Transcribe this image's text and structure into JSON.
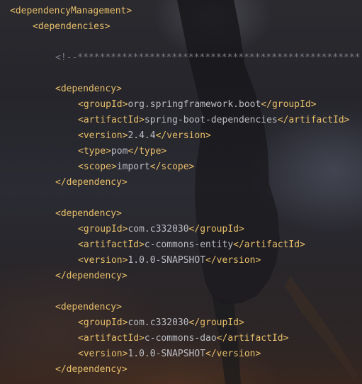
{
  "editor": {
    "colors": {
      "tag": "#e8bf6a",
      "text": "#bcbec4",
      "comment": "#7a7e85",
      "background": "#25252b"
    },
    "background_image": "dark-figure-with-guitar-wallpaper",
    "lines": [
      {
        "indent": 0,
        "segments": [
          {
            "kind": "tag",
            "text": "<dependencyManagement>"
          }
        ]
      },
      {
        "indent": 1,
        "segments": [
          {
            "kind": "tag",
            "text": "<dependencies>"
          }
        ]
      },
      {
        "indent": 0,
        "segments": []
      },
      {
        "indent": 2,
        "segments": [
          {
            "kind": "comment",
            "text": "<!--***************************************************"
          }
        ]
      },
      {
        "indent": 0,
        "segments": []
      },
      {
        "indent": 2,
        "segments": [
          {
            "kind": "tag",
            "text": "<dependency>"
          }
        ]
      },
      {
        "indent": 3,
        "segments": [
          {
            "kind": "tag",
            "text": "<groupId>"
          },
          {
            "kind": "txt",
            "text": "org.springframework.boot"
          },
          {
            "kind": "tag",
            "text": "</groupId>"
          }
        ]
      },
      {
        "indent": 3,
        "segments": [
          {
            "kind": "tag",
            "text": "<artifactId>"
          },
          {
            "kind": "txt",
            "text": "spring-boot-dependencies"
          },
          {
            "kind": "tag",
            "text": "</artifactId>"
          }
        ]
      },
      {
        "indent": 3,
        "segments": [
          {
            "kind": "tag",
            "text": "<version>"
          },
          {
            "kind": "txt",
            "text": "2.4.4"
          },
          {
            "kind": "tag",
            "text": "</version>"
          }
        ]
      },
      {
        "indent": 3,
        "segments": [
          {
            "kind": "tag",
            "text": "<type>"
          },
          {
            "kind": "txt",
            "text": "pom"
          },
          {
            "kind": "tag",
            "text": "</type>"
          }
        ]
      },
      {
        "indent": 3,
        "segments": [
          {
            "kind": "tag",
            "text": "<scope>"
          },
          {
            "kind": "txt",
            "text": "import"
          },
          {
            "kind": "tag",
            "text": "</scope>"
          }
        ]
      },
      {
        "indent": 2,
        "segments": [
          {
            "kind": "tag",
            "text": "</dependency>"
          }
        ]
      },
      {
        "indent": 0,
        "segments": []
      },
      {
        "indent": 2,
        "segments": [
          {
            "kind": "tag",
            "text": "<dependency>"
          }
        ]
      },
      {
        "indent": 3,
        "segments": [
          {
            "kind": "tag",
            "text": "<groupId>"
          },
          {
            "kind": "txt",
            "text": "com.c332030"
          },
          {
            "kind": "tag",
            "text": "</groupId>"
          }
        ]
      },
      {
        "indent": 3,
        "segments": [
          {
            "kind": "tag",
            "text": "<artifactId>"
          },
          {
            "kind": "txt",
            "text": "c-commons-entity"
          },
          {
            "kind": "tag",
            "text": "</artifactId>"
          }
        ]
      },
      {
        "indent": 3,
        "segments": [
          {
            "kind": "tag",
            "text": "<version>"
          },
          {
            "kind": "txt",
            "text": "1.0.0-SNAPSHOT"
          },
          {
            "kind": "tag",
            "text": "</version>"
          }
        ]
      },
      {
        "indent": 2,
        "segments": [
          {
            "kind": "tag",
            "text": "</dependency>"
          }
        ]
      },
      {
        "indent": 0,
        "segments": []
      },
      {
        "indent": 2,
        "segments": [
          {
            "kind": "tag",
            "text": "<dependency>"
          }
        ]
      },
      {
        "indent": 3,
        "segments": [
          {
            "kind": "tag",
            "text": "<groupId>"
          },
          {
            "kind": "txt",
            "text": "com.c332030"
          },
          {
            "kind": "tag",
            "text": "</groupId>"
          }
        ]
      },
      {
        "indent": 3,
        "segments": [
          {
            "kind": "tag",
            "text": "<artifactId>"
          },
          {
            "kind": "txt",
            "text": "c-commons-dao"
          },
          {
            "kind": "tag",
            "text": "</artifactId>"
          }
        ]
      },
      {
        "indent": 3,
        "segments": [
          {
            "kind": "tag",
            "text": "<version>"
          },
          {
            "kind": "txt",
            "text": "1.0.0-SNAPSHOT"
          },
          {
            "kind": "tag",
            "text": "</version>"
          }
        ]
      },
      {
        "indent": 2,
        "segments": [
          {
            "kind": "tag",
            "text": "</dependency>"
          }
        ]
      }
    ]
  }
}
